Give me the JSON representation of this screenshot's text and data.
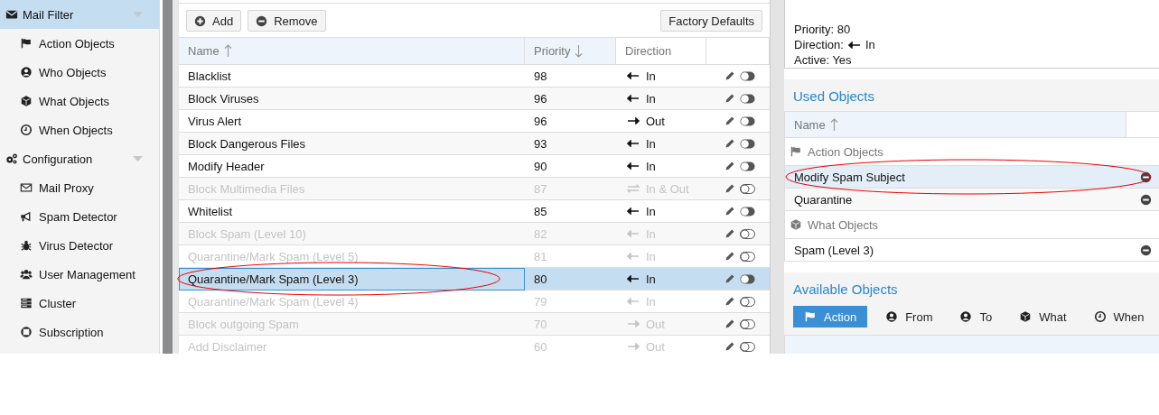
{
  "sidebar": {
    "sections": [
      {
        "label": "Mail Filter",
        "selected": true,
        "expanded": true,
        "children": [
          {
            "label": "Action Objects"
          },
          {
            "label": "Who Objects"
          },
          {
            "label": "What Objects"
          },
          {
            "label": "When Objects"
          }
        ]
      },
      {
        "label": "Configuration",
        "selected": false,
        "expanded": true,
        "children": [
          {
            "label": "Mail Proxy"
          },
          {
            "label": "Spam Detector"
          },
          {
            "label": "Virus Detector"
          },
          {
            "label": "User Management"
          },
          {
            "label": "Cluster"
          },
          {
            "label": "Subscription"
          }
        ]
      }
    ]
  },
  "toolbar": {
    "buttons": [
      "Add",
      "Remove"
    ],
    "defaults_button": "Factory Defaults"
  },
  "table": {
    "columns": [
      "Name",
      "Priority",
      "Direction"
    ],
    "rows": [
      {
        "name": "Blacklist",
        "priority": "98",
        "kind": "in",
        "direction": "In",
        "active": true,
        "selected": false,
        "annotated": false
      },
      {
        "name": "Block Viruses",
        "priority": "96",
        "kind": "in",
        "direction": "In",
        "active": true,
        "selected": false,
        "annotated": false
      },
      {
        "name": "Virus Alert",
        "priority": "96",
        "kind": "out",
        "direction": "Out",
        "active": true,
        "selected": false,
        "annotated": false
      },
      {
        "name": "Block Dangerous Files",
        "priority": "93",
        "kind": "in",
        "direction": "In",
        "active": true,
        "selected": false,
        "annotated": false
      },
      {
        "name": "Modify Header",
        "priority": "90",
        "kind": "in",
        "direction": "In",
        "active": true,
        "selected": false,
        "annotated": false
      },
      {
        "name": "Block Multimedia Files",
        "priority": "87",
        "kind": "both",
        "direction": "In & Out",
        "active": false,
        "selected": false,
        "annotated": false
      },
      {
        "name": "Whitelist",
        "priority": "85",
        "kind": "in",
        "direction": "In",
        "active": true,
        "selected": false,
        "annotated": false
      },
      {
        "name": "Block Spam (Level 10)",
        "priority": "82",
        "kind": "in",
        "direction": "In",
        "active": false,
        "selected": false,
        "annotated": false
      },
      {
        "name": "Quarantine/Mark Spam (Level 5)",
        "priority": "81",
        "kind": "in",
        "direction": "In",
        "active": false,
        "selected": false,
        "annotated": false
      },
      {
        "name": "Quarantine/Mark Spam (Level 3)",
        "priority": "80",
        "kind": "in",
        "direction": "In",
        "active": true,
        "selected": true,
        "annotated": true
      },
      {
        "name": "Quarantine/Mark Spam (Level 4)",
        "priority": "79",
        "kind": "in",
        "direction": "In",
        "active": false,
        "selected": false,
        "annotated": false
      },
      {
        "name": "Block outgoing Spam",
        "priority": "70",
        "kind": "out",
        "direction": "Out",
        "active": false,
        "selected": false,
        "annotated": false
      },
      {
        "name": "Add Disclaimer",
        "priority": "60",
        "kind": "out",
        "direction": "Out",
        "active": false,
        "selected": false,
        "annotated": false
      }
    ]
  },
  "details": {
    "priority": "Priority: 80",
    "direction_label": "Direction:",
    "direction": {
      "kind": "in",
      "text": "In"
    },
    "active": "Active: Yes"
  },
  "used_objects": {
    "title": "Used Objects",
    "column": "Name",
    "groups": [
      {
        "label": "Action Objects",
        "items": [
          {
            "name": "Modify Spam Subject",
            "selected": true,
            "annotated": true
          },
          {
            "name": "Quarantine",
            "selected": false,
            "annotated": false
          }
        ]
      },
      {
        "label": "What Objects",
        "items": [
          {
            "name": "Spam (Level 3)",
            "selected": false,
            "annotated": false
          }
        ]
      }
    ]
  },
  "available_objects": {
    "title": "Available Objects",
    "tabs": [
      {
        "label": "Action",
        "selected": true
      },
      {
        "label": "From",
        "selected": false
      },
      {
        "label": "To",
        "selected": false
      },
      {
        "label": "What",
        "selected": false
      },
      {
        "label": "When",
        "selected": false
      }
    ]
  }
}
